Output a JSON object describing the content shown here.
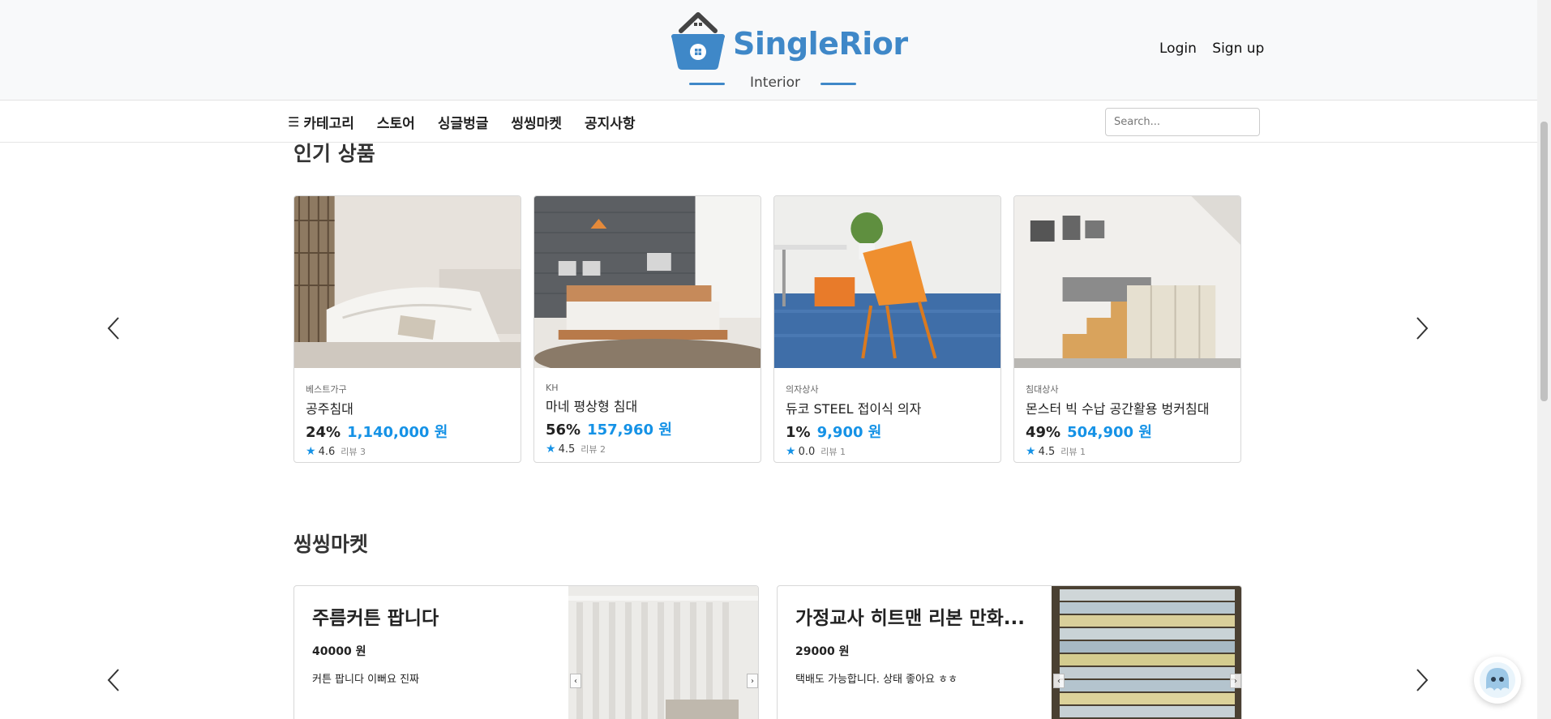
{
  "header": {
    "brand": "SingleRior",
    "subtitle": "Interior",
    "login": "Login",
    "signup": "Sign up"
  },
  "nav": {
    "items": [
      "카테고리",
      "스토어",
      "싱글벙글",
      "씽씽마켓",
      "공지사항"
    ],
    "search_placeholder": "Search..."
  },
  "popular": {
    "title": "인기 상품",
    "products": [
      {
        "brand": "베스트가구",
        "name": "공주침대",
        "discount": "24%",
        "price": "1,140,000 원",
        "rating": "4.6",
        "reviews": "리뷰 3"
      },
      {
        "brand": "KH",
        "name": "마네 평상형 침대",
        "discount": "56%",
        "price": "157,960 원",
        "rating": "4.5",
        "reviews": "리뷰 2"
      },
      {
        "brand": "의자상사",
        "name": "듀코 STEEL 접이식 의자",
        "discount": "1%",
        "price": "9,900 원",
        "rating": "0.0",
        "reviews": "리뷰 1"
      },
      {
        "brand": "침대상사",
        "name": "몬스터 빅 수납 공간활용 벙커침대",
        "discount": "49%",
        "price": "504,900 원",
        "rating": "4.5",
        "reviews": "리뷰 1"
      }
    ]
  },
  "market": {
    "title": "씽씽마켓",
    "items": [
      {
        "title": "주름커튼 팝니다",
        "price": "40000 원",
        "desc": "커튼 팝니다 이뻐요 진짜"
      },
      {
        "title": "가정교사 히트맨 리본 만화...",
        "price": "29000 원",
        "desc": "택배도 가능합니다. 상태 좋아요 ㅎㅎ"
      }
    ]
  },
  "colors": {
    "accent": "#3f88c8",
    "price": "#1592e6"
  }
}
